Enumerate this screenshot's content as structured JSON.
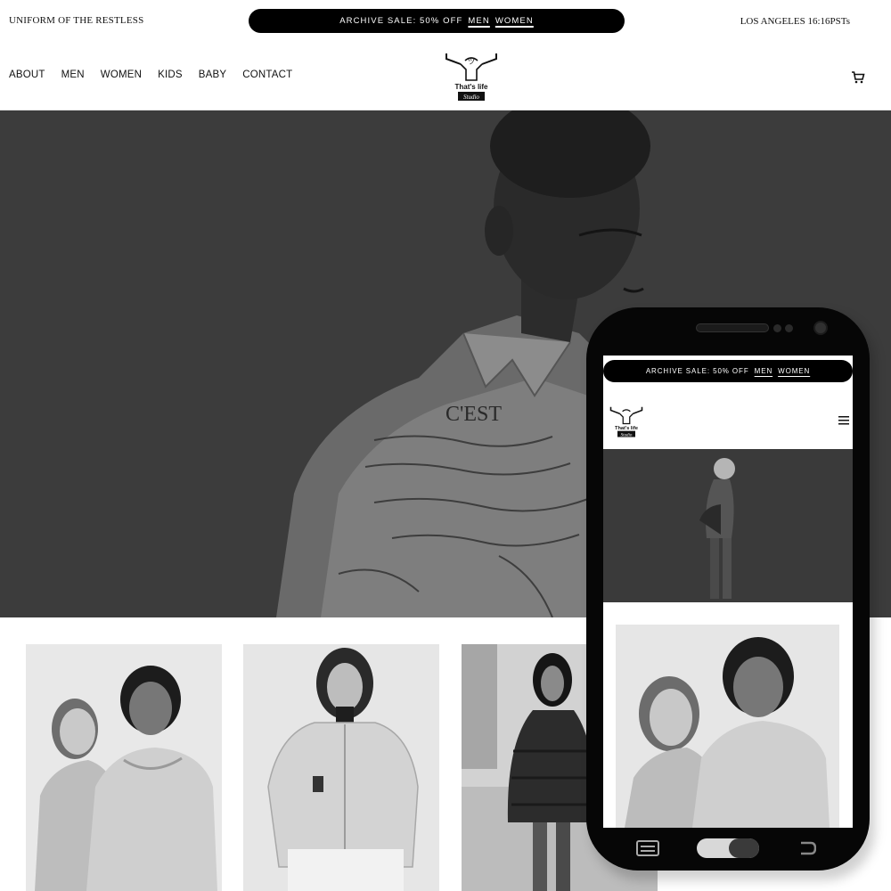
{
  "header": {
    "tagline": "UNIFORM OF THE RESTLESS",
    "sale": {
      "text": "ARCHIVE SALE: 50% OFF",
      "men_link": "MEN",
      "women_link": "WOMEN"
    },
    "clock": "LOS ANGELES 16:16PSTs"
  },
  "nav": {
    "items": [
      {
        "label": "ABOUT"
      },
      {
        "label": "MEN"
      },
      {
        "label": "WOMEN"
      },
      {
        "label": "KIDS"
      },
      {
        "label": "BABY"
      },
      {
        "label": "CONTACT"
      }
    ],
    "cart_icon": "cart-icon"
  },
  "logo": {
    "line1": "That's life",
    "line2": "Studio"
  },
  "mobile": {
    "sale": {
      "text": "ARCHIVE SALE: 50% OFF",
      "men_link": "MEN",
      "women_link": "WOMEN"
    },
    "menu_icon": "hamburger-icon",
    "logo": {
      "line1": "That's life",
      "line2": "Studio"
    }
  },
  "hero": {
    "shirt_text": "C'EST"
  },
  "colors": {
    "background": "#ffffff",
    "accent": "#000000",
    "hero": "#3c3c3c"
  },
  "icons": [
    "cart-icon",
    "hamburger-icon",
    "recent-apps-icon",
    "home-button",
    "back-icon"
  ]
}
